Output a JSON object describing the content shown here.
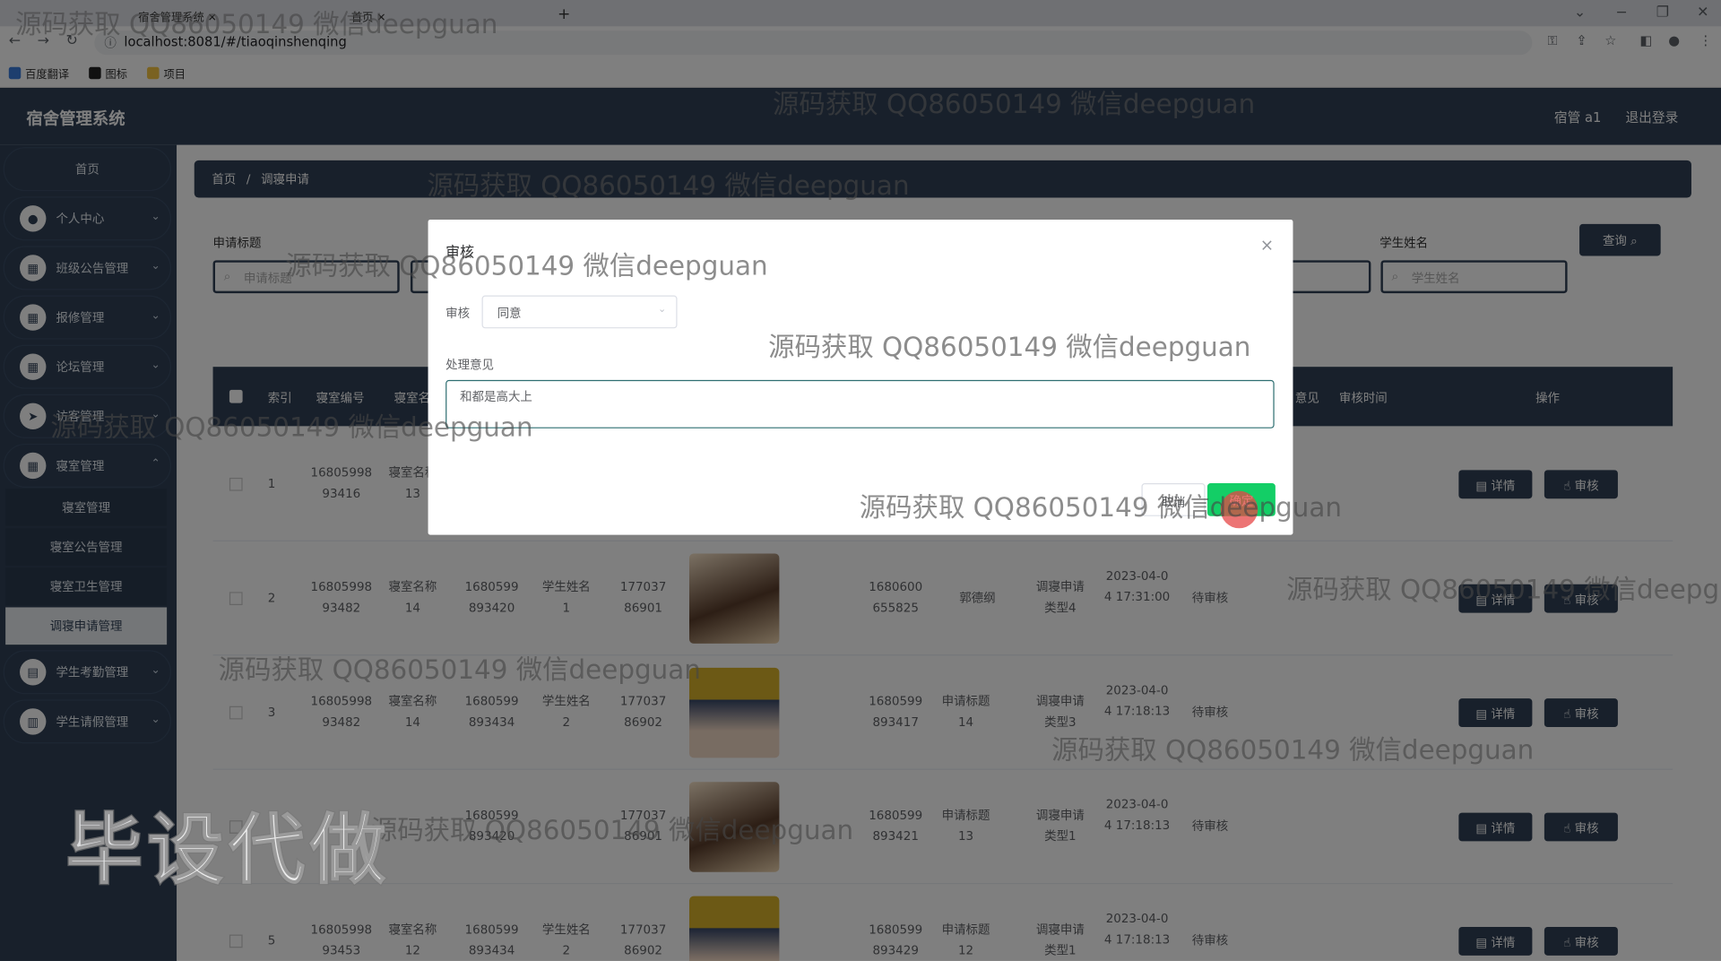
{
  "browser": {
    "tabs": [
      "宿舍管理系统",
      "首页"
    ],
    "new_tab": "+",
    "url": "localhost:8081/#/tiaoqinshenqing",
    "bookmarks": [
      "百度翻译",
      "图标",
      "项目"
    ]
  },
  "app": {
    "title": "宿舍管理系统",
    "user": "宿管 a1",
    "logout": "退出登录"
  },
  "sidebar": {
    "home": "首页",
    "items": [
      "个人中心",
      "班级公告管理",
      "报修管理",
      "论坛管理",
      "访客管理",
      "寝室管理",
      "学生考勤管理",
      "学生请假管理"
    ],
    "sub_items": [
      "寝室管理",
      "寝室公告管理",
      "寝室卫生管理",
      "调寝申请管理"
    ]
  },
  "breadcrumb": {
    "home": "首页",
    "sep": "/",
    "current": "调寝申请"
  },
  "filters": {
    "label1": "申请标题",
    "placeholder1": "申请标题",
    "label_student": "学生姓名",
    "placeholder_student": "学生姓名",
    "query": "查询"
  },
  "table": {
    "headers": [
      "索引",
      "寝室编号",
      "寝室名称",
      "操作",
      "审核时间",
      "意见"
    ],
    "detail_btn": "详情",
    "review_btn": "审核",
    "rows": [
      {
        "idx": "1",
        "room_no": "1680599893416",
        "room_name": "寝室名称13",
        "c3": "",
        "c4": "",
        "c5": "",
        "c6": "",
        "c7": "",
        "c8": "",
        "time": "",
        "status": ""
      },
      {
        "idx": "2",
        "room_no": "1680599893482",
        "room_name": "寝室名称14",
        "c3": "1680599893420",
        "c4": "学生姓名1",
        "c5": "17703786901",
        "c6": "1680600655825",
        "c7": "郭德纲",
        "c8": "调寝申请类型4",
        "time": "2023-04-04 17:31:00",
        "status": "待审核"
      },
      {
        "idx": "3",
        "room_no": "1680599893482",
        "room_name": "寝室名称14",
        "c3": "1680599893434",
        "c4": "学生姓名2",
        "c5": "17703786902",
        "c6": "1680599893417",
        "c7": "申请标题14",
        "c8": "调寝申请类型3",
        "time": "2023-04-04 17:18:13",
        "status": "待审核"
      },
      {
        "idx": "",
        "room_no": "",
        "room_name": "",
        "c3": "1680599893420",
        "c4": "",
        "c5": "17703786901",
        "c6": "1680599893421",
        "c7": "申请标题13",
        "c8": "调寝申请类型1",
        "time": "2023-04-04 17:18:13",
        "status": "待审核"
      },
      {
        "idx": "5",
        "room_no": "1680599893453",
        "room_name": "寝室名称12",
        "c3": "1680599893434",
        "c4": "学生姓名2",
        "c5": "17703786902",
        "c6": "1680599893429",
        "c7": "申请标题12",
        "c8": "调寝申请类型1",
        "time": "2023-04-04 17:18:13",
        "status": "待审核"
      }
    ]
  },
  "dialog": {
    "title": "审核",
    "close": "×",
    "review_label": "审核",
    "review_value": "同意",
    "opinion_label": "处理意见",
    "opinion_value": "和都是高大上",
    "cancel": "取消",
    "ok": "确定"
  },
  "watermark": {
    "text": "源码获取 QQ86050149 微信deepguan",
    "big": "毕设代做"
  }
}
